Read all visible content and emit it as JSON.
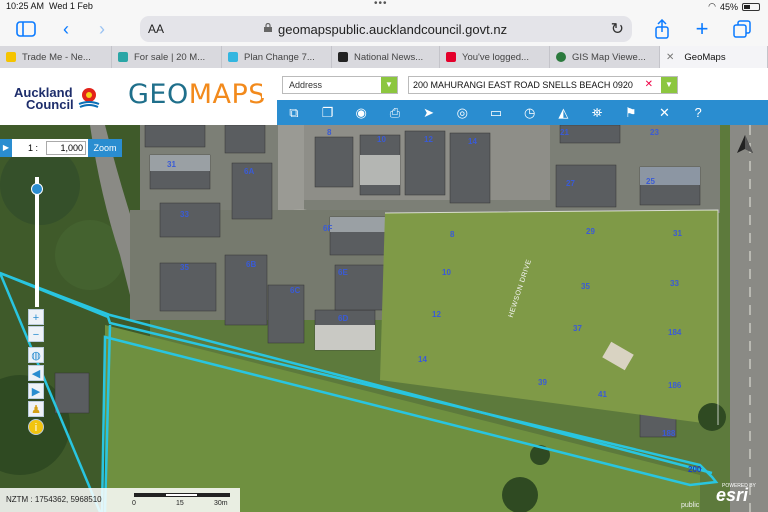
{
  "status_bar": {
    "time": "10:25 AM",
    "date": "Wed 1 Feb",
    "battery": "45%",
    "battery_level": 0.45
  },
  "browser": {
    "aa_label": "AA",
    "url": "geomapspublic.aucklandcouncil.govt.nz",
    "accent_color": "#0a7aff",
    "icons": [
      "sidebar-icon",
      "back-icon",
      "forward-icon",
      "lock-icon",
      "reload-icon",
      "share-icon",
      "new-tab-icon",
      "tabs-icon"
    ]
  },
  "tabs": [
    {
      "label": "Trade Me - Ne...",
      "color": "#f5c400",
      "active": false
    },
    {
      "label": "For sale | 20 M...",
      "color": "#2aa6a6",
      "active": false
    },
    {
      "label": "Plan Change 7...",
      "color": "#33b6e0",
      "active": false
    },
    {
      "label": "National News...",
      "color": "#222222",
      "active": false
    },
    {
      "label": "You've logged...",
      "color": "#e4002b",
      "active": false
    },
    {
      "label": "GIS Map Viewe...",
      "color": "#2b7a3d",
      "active": false
    },
    {
      "label": "GeoMaps",
      "color": "#ffffff",
      "active": true
    }
  ],
  "app": {
    "logo_line1": "Auckland",
    "logo_line2": "Council",
    "title_geo": "GEO",
    "title_maps": "MAPS",
    "search_type": "Address",
    "address_value": "200 MAHURANGI EAST ROAD SNELLS BEACH 0920",
    "brand_color": "#2a8dd0",
    "accent_green": "#8cc63f",
    "tools": [
      "layers-icon",
      "basemap-icon",
      "eye-icon",
      "print-icon",
      "select-icon",
      "locate-icon",
      "measure-icon",
      "history-icon",
      "streetview-icon",
      "property-icon",
      "bookmark-icon",
      "tools-icon",
      "help-icon"
    ],
    "tool_labels": [
      "⧉",
      "❐",
      "◉",
      "⎙",
      "➤",
      "◎",
      "▭",
      "◷",
      "◭",
      "⛯",
      "⚑",
      "✕",
      "?"
    ]
  },
  "map": {
    "scale_label": "1 :",
    "scale_value": "1,000",
    "zoom_button": "Zoom",
    "coords": "NZTM : 1754362, 5968510",
    "scalebar_labels": [
      "0",
      "15",
      "30m"
    ],
    "esri_label": "esri",
    "powered_label": "POWERED BY",
    "public_label": "public",
    "street_name": "HEWSON DRIVE",
    "lot_numbers": [
      "8",
      "10",
      "12",
      "14",
      "21",
      "23",
      "31",
      "6A",
      "33",
      "35",
      "6B",
      "6C",
      "6D",
      "6E",
      "6F",
      "8",
      "10",
      "12",
      "14",
      "25",
      "27",
      "29",
      "31",
      "33",
      "35",
      "37",
      "39",
      "41",
      "184",
      "186",
      "188",
      "200"
    ],
    "boundary_color": "#29c5e0"
  }
}
